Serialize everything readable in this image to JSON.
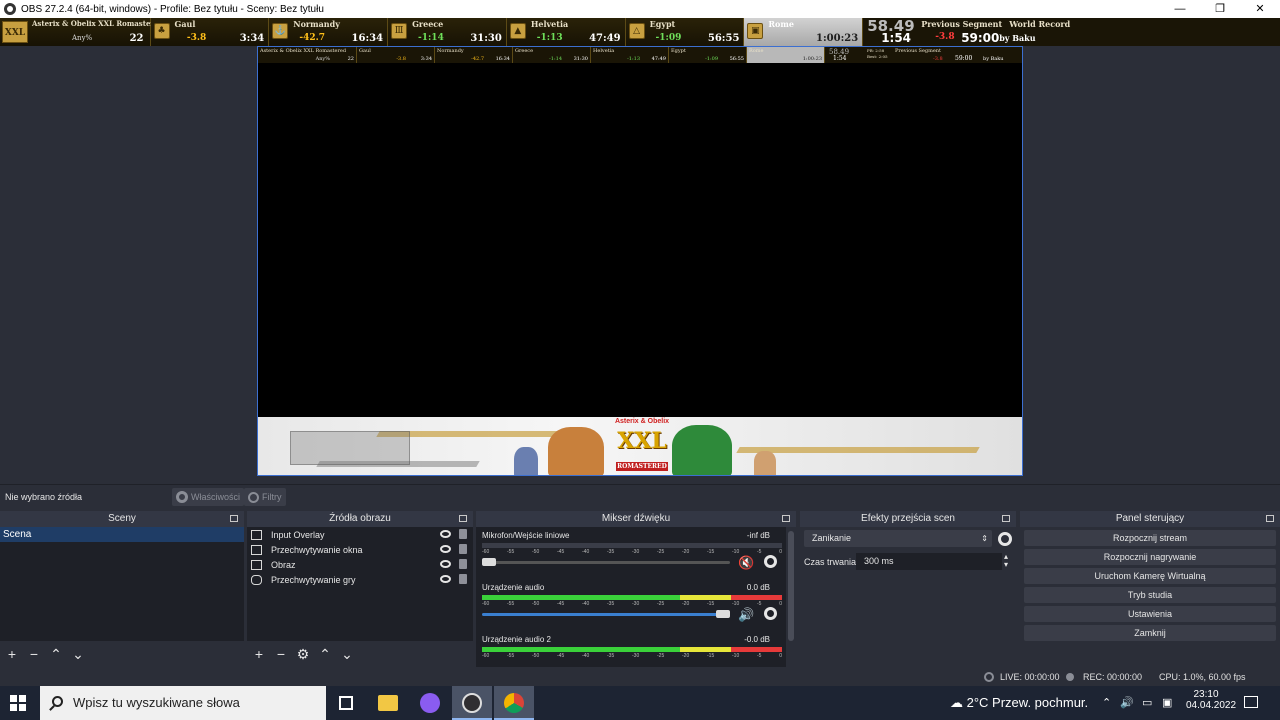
{
  "window": {
    "title": "OBS 27.2.4 (64-bit, windows) - Profile: Bez tytułu - Sceny: Bez tytułu",
    "minimize": "—",
    "restore": "❐",
    "close": "✕"
  },
  "splits": {
    "game_title": "Asterix & Obelix XXL Romastered",
    "category": "Any%",
    "attempts": "22",
    "logo": "XXL",
    "segments": [
      {
        "name": "Gaul",
        "delta": "-3.8",
        "time": "3:34",
        "delta_type": "pos"
      },
      {
        "name": "Normandy",
        "delta": "-42.7",
        "time": "16:34",
        "delta_type": "pos"
      },
      {
        "name": "Greece",
        "delta": "-1:14",
        "time": "31:30",
        "delta_type": "neg"
      },
      {
        "name": "Helvetia",
        "delta": "-1:13",
        "time": "47:49",
        "delta_type": "neg"
      },
      {
        "name": "Egypt",
        "delta": "-1:09",
        "time": "56:55",
        "delta_type": "neg"
      },
      {
        "name": "Rome",
        "delta": "",
        "time": "1:00:23",
        "delta_type": "current"
      }
    ],
    "running_time": "58.49",
    "segment_time": "1:54",
    "prev_segment_label": "Previous Segment",
    "prev_segment_delta": "-3.8",
    "world_record_label": "World Record",
    "world_record_time": "59:00",
    "world_record_by": "by Baku",
    "mini_pb": "PB: 2:58",
    "mini_best": "Best: 2:05"
  },
  "properties_bar": {
    "no_source": "Nie wybrano źródła",
    "properties": "Właściwości",
    "filters": "Filtry"
  },
  "docks": {
    "scenes": {
      "title": "Sceny",
      "items": [
        "Scena"
      ]
    },
    "sources": {
      "title": "Źródła obrazu",
      "items": [
        "Input Overlay",
        "Przechwytywanie okna",
        "Obraz",
        "Przechwytywanie gry"
      ]
    },
    "mixer": {
      "title": "Mikser dźwięku",
      "channels": [
        {
          "name": "Mikrofon/Wejście liniowe",
          "db": "-inf dB",
          "level": 0.0,
          "muted": true
        },
        {
          "name": "Urządzenie audio",
          "db": "0.0 dB",
          "level": 1.0,
          "muted": false
        },
        {
          "name": "Urządzenie audio 2",
          "db": "-0.0 dB",
          "level": 1.0,
          "muted": false
        }
      ],
      "scale": [
        "-60",
        "-55",
        "-50",
        "-45",
        "-40",
        "-35",
        "-30",
        "-25",
        "-20",
        "-15",
        "-10",
        "-5",
        "0"
      ]
    },
    "transitions": {
      "title": "Efekty przejścia scen",
      "selected": "Zanikanie",
      "duration_label": "Czas trwania",
      "duration_value": "300 ms"
    },
    "controls": {
      "title": "Panel sterujący",
      "buttons": [
        "Rozpocznij stream",
        "Rozpocznij nagrywanie",
        "Uruchom Kamerę Wirtualną",
        "Tryb studia",
        "Ustawienia",
        "Zamknij"
      ]
    }
  },
  "status": {
    "live": "LIVE: 00:00:00",
    "rec": "REC: 00:00:00",
    "cpu": "CPU: 1.0%, 60.00 fps"
  },
  "taskbar": {
    "search_placeholder": "Wpisz tu wyszukiwane słowa",
    "weather": "2°C  Przew. pochmur.",
    "time": "23:10",
    "date": "04.04.2022"
  },
  "banner": {
    "logo_top": "Asterix & Obelix",
    "logo_main": "XXL",
    "logo_sub": "ROMASTERED"
  },
  "colors": {
    "accent": "#3c6fd0",
    "obs_bg": "#2b2e38",
    "delta_ahead": "#6fe05a",
    "delta_behind": "#ffc01a",
    "delta_bad": "#ff3d3d"
  }
}
